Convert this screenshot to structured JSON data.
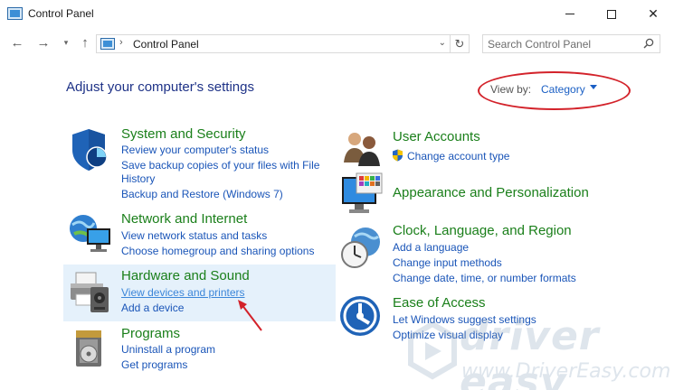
{
  "window": {
    "title": "Control Panel"
  },
  "address_bar": {
    "path": "Control Panel",
    "search_placeholder": "Search Control Panel"
  },
  "header": {
    "heading": "Adjust your computer's settings",
    "view_by_label": "View by:",
    "view_by_value": "Category"
  },
  "categories": {
    "system_security": {
      "title": "System and Security",
      "links": [
        "Review your computer's status",
        "Save backup copies of your files with File",
        "History",
        "Backup and Restore (Windows 7)"
      ]
    },
    "network": {
      "title": "Network and Internet",
      "links": [
        "View network status and tasks",
        "Choose homegroup and sharing options"
      ]
    },
    "hardware": {
      "title": "Hardware and Sound",
      "links": [
        "View devices and printers",
        "Add a device"
      ]
    },
    "programs": {
      "title": "Programs",
      "links": [
        "Uninstall a program",
        "Get programs"
      ]
    },
    "user_accounts": {
      "title": "User Accounts",
      "links": [
        "Change account type"
      ]
    },
    "appearance": {
      "title": "Appearance and Personalization"
    },
    "clock": {
      "title": "Clock, Language, and Region",
      "links": [
        "Add a language",
        "Change input methods",
        "Change date, time, or number formats"
      ]
    },
    "ease": {
      "title": "Ease of Access",
      "links": [
        "Let Windows suggest settings",
        "Optimize visual display"
      ]
    }
  },
  "watermark": {
    "brand": "driver easy",
    "url": "www.DriverEasy.com"
  },
  "colors": {
    "heading": "#1e3287",
    "category_title": "#1a7f1a",
    "link": "#1a55b8",
    "highlight": "#e5f1fb",
    "annotation": "#d3222a"
  }
}
